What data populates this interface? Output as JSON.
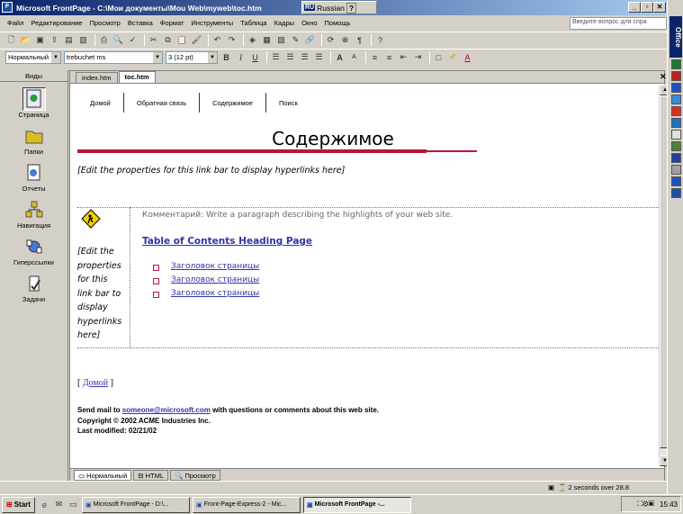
{
  "window": {
    "title": "Microsoft FrontPage - C:\\Мои документы\\Mou Web\\myweb\\toc.htm",
    "lang_code": "RU",
    "lang_name": "Russian",
    "btn_min": "_",
    "btn_max": "▫",
    "btn_close": "✕"
  },
  "menu": {
    "items": [
      "Файл",
      "Редактирование",
      "Просмотр",
      "Вставка",
      "Формат",
      "Инструменты",
      "Таблица",
      "Кадры",
      "Окно",
      "Помощь"
    ],
    "ask_placeholder": "Введите вопрос для спра"
  },
  "format_bar": {
    "style": "Нормальный",
    "font": "trebuchet ms",
    "size": "3 (12 pt)"
  },
  "views": {
    "header": "Виды",
    "items": [
      {
        "label": "Страница",
        "icon": "page-view-icon",
        "selected": true
      },
      {
        "label": "Папки",
        "icon": "folders-view-icon",
        "selected": false
      },
      {
        "label": "Отчеты",
        "icon": "reports-view-icon",
        "selected": false
      },
      {
        "label": "Навигация",
        "icon": "navigation-view-icon",
        "selected": false
      },
      {
        "label": "Гиперссылки",
        "icon": "hyperlinks-view-icon",
        "selected": false
      },
      {
        "label": "Задачи",
        "icon": "tasks-view-icon",
        "selected": false
      }
    ]
  },
  "tabs": [
    "index.htm",
    "toc.htm"
  ],
  "page": {
    "nav_links": [
      "Домой",
      "Обратная связь",
      "Содержимое",
      "Поиск"
    ],
    "title": "Содержимое",
    "linkbar_placeholder": "[Edit the properties for this link bar to display hyperlinks here]",
    "side_placeholder": [
      "[Edit the",
      "properties",
      "for this",
      "link bar to",
      "display",
      "hyperlinks",
      "here]"
    ],
    "comment": "Комментарий: Write a paragraph describing the highlights of your web site.",
    "toc_heading": "Table of Contents Heading Page",
    "toc_items": [
      "Заголовок страницы",
      "Заголовок страницы",
      "Заголовок страницы"
    ],
    "home_bracket_open": "[",
    "home_link": "Домой",
    "home_bracket_close": "]",
    "footer_mail_prefix": "Send mail to",
    "footer_email": "someone@microsoft.com",
    "footer_mail_suffix": "with questions or comments about this web site.",
    "copyright": "Copyright © 2002 ACME Industries Inc.",
    "modified": "Last modified: 02/21/02"
  },
  "view_tabs": [
    "Нормальный",
    "HTML",
    "Просмотр"
  ],
  "status": {
    "text": "2 seconds over 28.8"
  },
  "taskbar": {
    "start": "Start",
    "tasks": [
      "Microsoft FrontPage - D:\\...",
      "Front-Page-Express-2 - Mic...",
      "Microsoft FrontPage -..."
    ],
    "clock": "15:43"
  },
  "office_bar": {
    "label": "Office"
  }
}
